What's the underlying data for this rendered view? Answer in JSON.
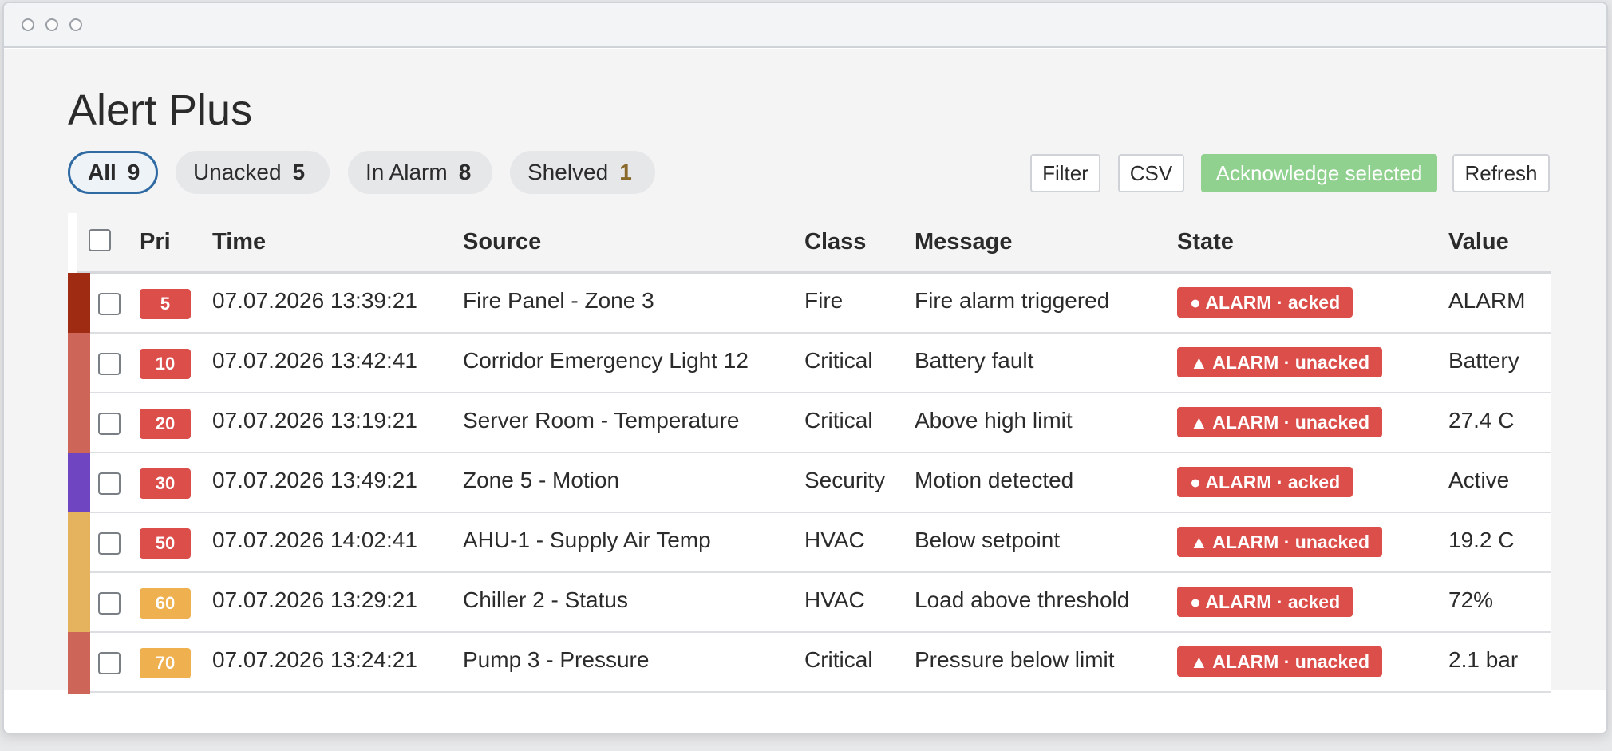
{
  "app": {
    "title": "Alert Plus"
  },
  "filters": [
    {
      "label": "All",
      "count": "9",
      "active": true
    },
    {
      "label": "Unacked",
      "count": "5"
    },
    {
      "label": "In Alarm",
      "count": "8"
    },
    {
      "label": "Shelved",
      "count": "1"
    }
  ],
  "toolbar": {
    "filter": "Filter",
    "csv": "CSV",
    "acknowledge": "Acknowledge selected",
    "refresh": "Refresh"
  },
  "table": {
    "columns": [
      "Pri",
      "Time",
      "Source",
      "Class",
      "Message",
      "State",
      "Value"
    ],
    "rows": [
      {
        "pri": "5",
        "time": "07.07.2026 13:39:21",
        "source": "Fire Panel - Zone 3",
        "class": "Fire",
        "message": "Fire alarm triggered",
        "state": "● ALARM · acked",
        "value": "ALARM",
        "strip_color": "#9e2b12",
        "pri_color": "#dc4e4a"
      },
      {
        "pri": "10",
        "time": "07.07.2026 13:42:41",
        "source": "Corridor Emergency Light 12",
        "class": "Critical",
        "message": "Battery fault",
        "state": "▲ ALARM · unacked",
        "value": "Battery",
        "strip_color": "#cd6558",
        "pri_color": "#dc4e4a"
      },
      {
        "pri": "20",
        "time": "07.07.2026 13:19:21",
        "source": "Server Room - Temperature",
        "class": "Critical",
        "message": "Above high limit",
        "state": "▲ ALARM · unacked",
        "value": "27.4 C",
        "strip_color": "#cd6558",
        "pri_color": "#dc4e4a"
      },
      {
        "pri": "30",
        "time": "07.07.2026 13:49:21",
        "source": "Zone 5 - Motion",
        "class": "Security",
        "message": "Motion detected",
        "state": "● ALARM · acked",
        "value": "Active",
        "strip_color": "#6f45c1",
        "pri_color": "#dc4e4a"
      },
      {
        "pri": "50",
        "time": "07.07.2026 14:02:41",
        "source": "AHU-1 - Supply Air Temp",
        "class": "HVAC",
        "message": "Below setpoint",
        "state": "▲ ALARM · unacked",
        "value": "19.2 C",
        "strip_color": "#e5b35d",
        "pri_color": "#dc4e4a"
      },
      {
        "pri": "60",
        "time": "07.07.2026 13:29:21",
        "source": "Chiller 2 - Status",
        "class": "HVAC",
        "message": "Load above threshold",
        "state": "● ALARM · acked",
        "value": "72%",
        "strip_color": "#e5b35d",
        "pri_color": "#efb04f"
      },
      {
        "pri": "70",
        "time": "07.07.2026 13:24:21",
        "source": "Pump 3 - Pressure",
        "class": "Critical",
        "message": "Pressure below limit",
        "state": "▲ ALARM · unacked",
        "value": "2.1 bar",
        "strip_color": "#cd6558",
        "pri_color": "#efb04f"
      }
    ]
  }
}
